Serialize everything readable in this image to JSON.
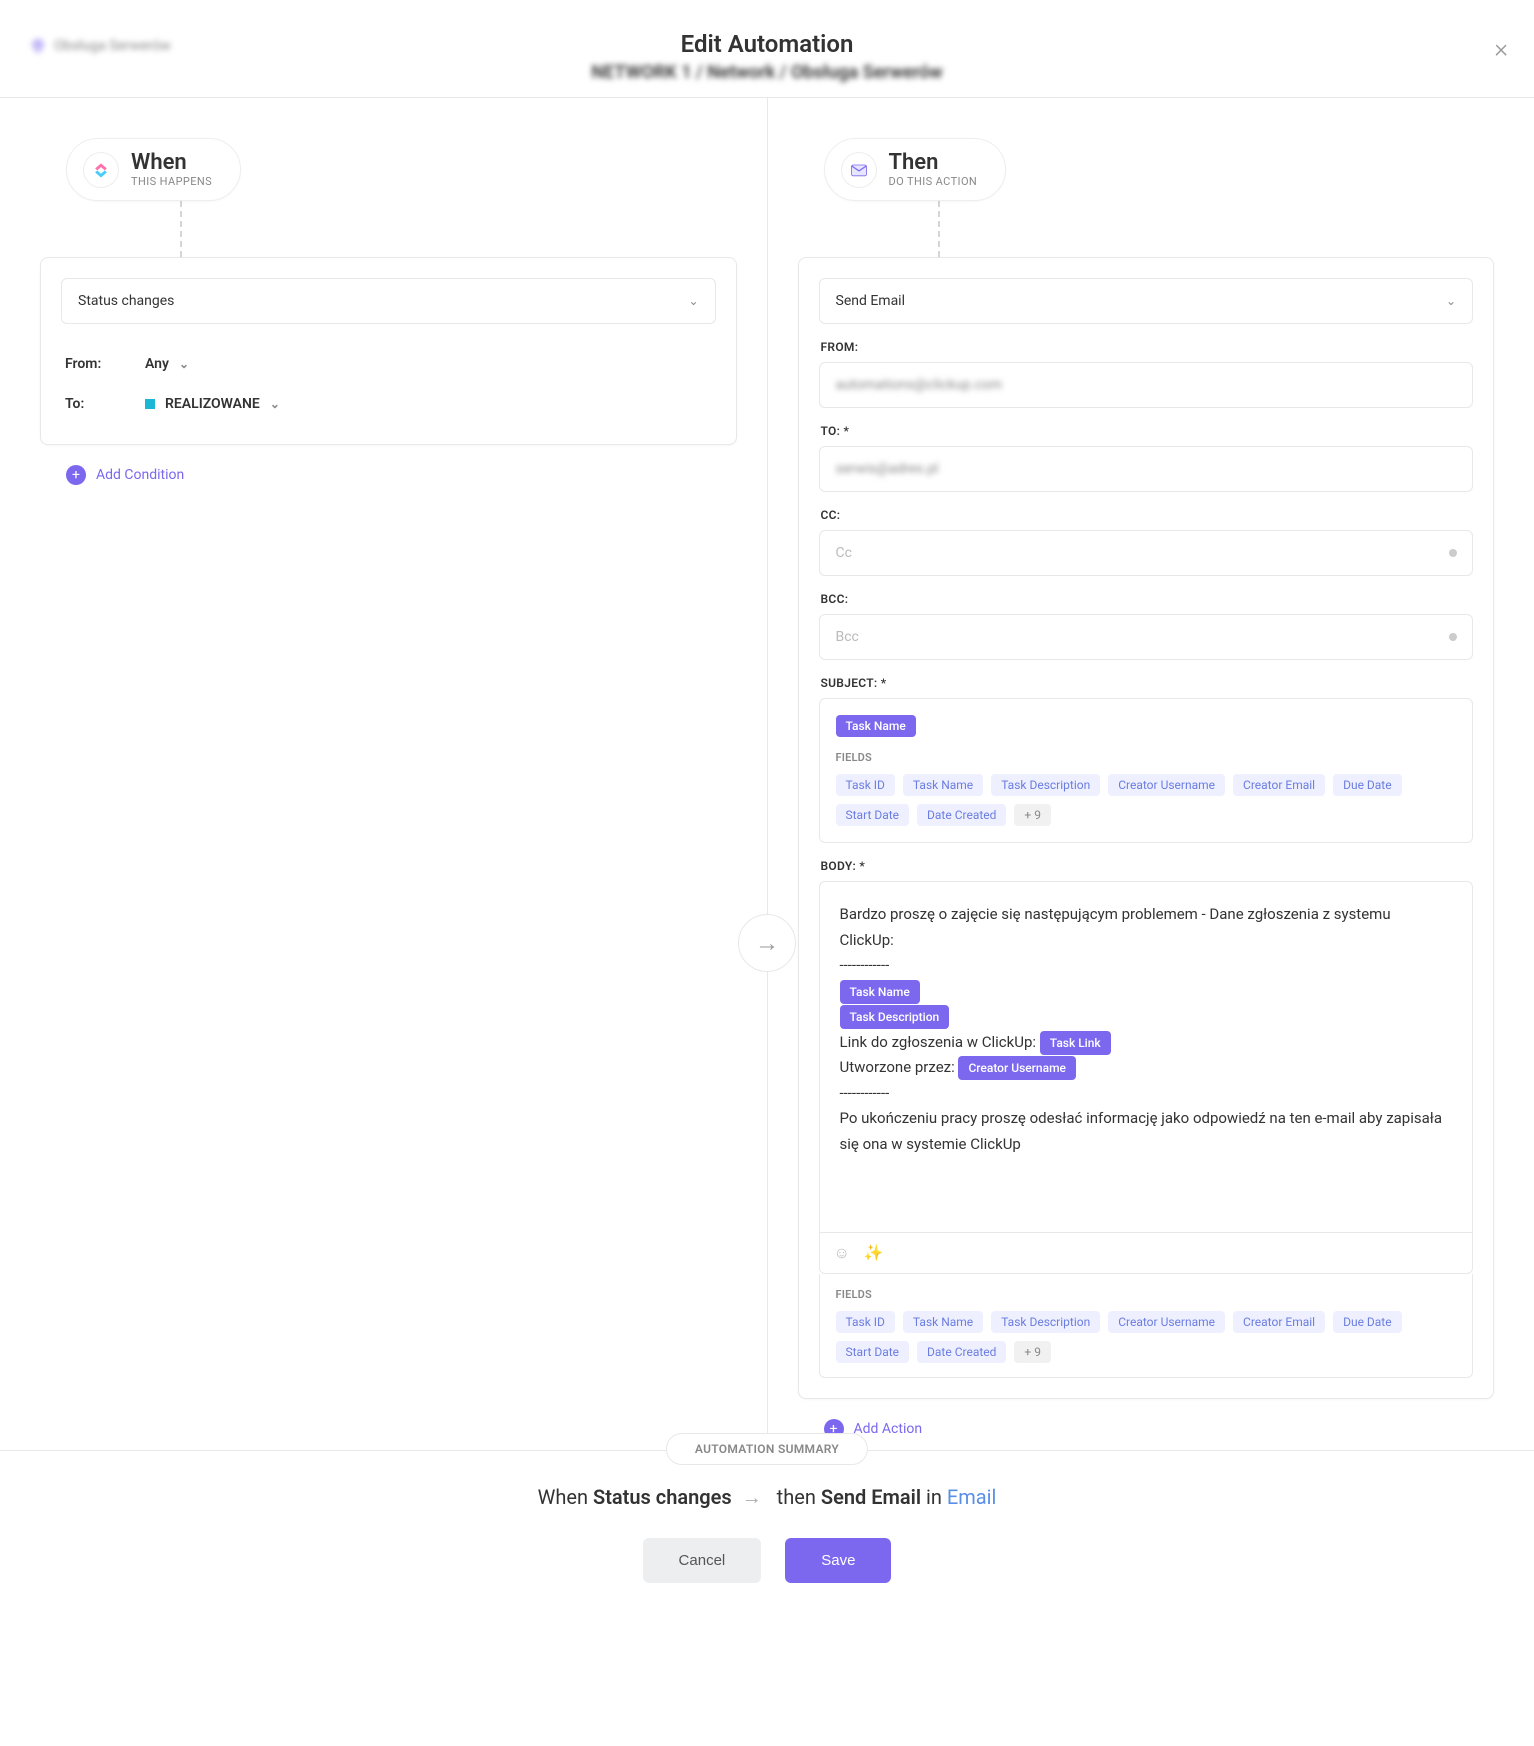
{
  "header": {
    "title": "Edit Automation",
    "location": "Obsługa Serwerów",
    "breadcrumb": "NETWORK 1 / Network / Obsługa Serwerów"
  },
  "when": {
    "title": "When",
    "subtitle": "THIS HAPPENS",
    "trigger_label": "Status changes",
    "from_label": "From:",
    "from_value": "Any",
    "to_label": "To:",
    "to_value": "REALIZOWANE",
    "add_condition": "Add Condition"
  },
  "then": {
    "title": "Then",
    "subtitle": "DO THIS ACTION",
    "action": "Send Email",
    "from_label": "FROM:",
    "from_value": "automations@clickup.com",
    "to_label": "TO: *",
    "to_value": "serwis@adres.pl",
    "cc_label": "CC:",
    "cc_placeholder": "Cc",
    "bcc_label": "BCC:",
    "bcc_placeholder": "Bcc",
    "subject_label": "SUBJECT: *",
    "subject_token": "Task Name",
    "fields_heading": "FIELDS",
    "subject_chips": [
      "Task ID",
      "Task Name",
      "Task Description",
      "Creator Username",
      "Creator Email",
      "Due Date",
      "Start Date",
      "Date Created"
    ],
    "subject_chip_more": "+ 9",
    "body_label": "BODY: *",
    "body_p1": "Bardzo proszę o zajęcie się następującym problemem - Dane zgłoszenia z systemu ClickUp:",
    "body_dashes": "------------",
    "body_token_name": "Task Name",
    "body_token_desc": "Task Description",
    "body_link_text": "Link do zgłoszenia w ClickUp: ",
    "body_token_link": "Task Link",
    "body_created_by": "Utworzone przez: ",
    "body_token_creator": "Creator Username",
    "body_p2": "Po ukończeniu pracy proszę odesłać informację jako odpowiedź na ten e-mail aby zapisała się ona w systemie ClickUp",
    "body_chips": [
      "Task ID",
      "Task Name",
      "Task Description",
      "Creator Username",
      "Creator Email",
      "Due Date",
      "Start Date",
      "Date Created"
    ],
    "body_chip_more": "+ 9",
    "add_action": "Add Action"
  },
  "summary": {
    "pill": "AUTOMATION SUMMARY",
    "when_text": "When ",
    "when_bold": "Status changes",
    "then_text": " then ",
    "then_bold": "Send Email",
    "in_text": " in ",
    "in_link": "Email"
  },
  "buttons": {
    "cancel": "Cancel",
    "save": "Save"
  }
}
